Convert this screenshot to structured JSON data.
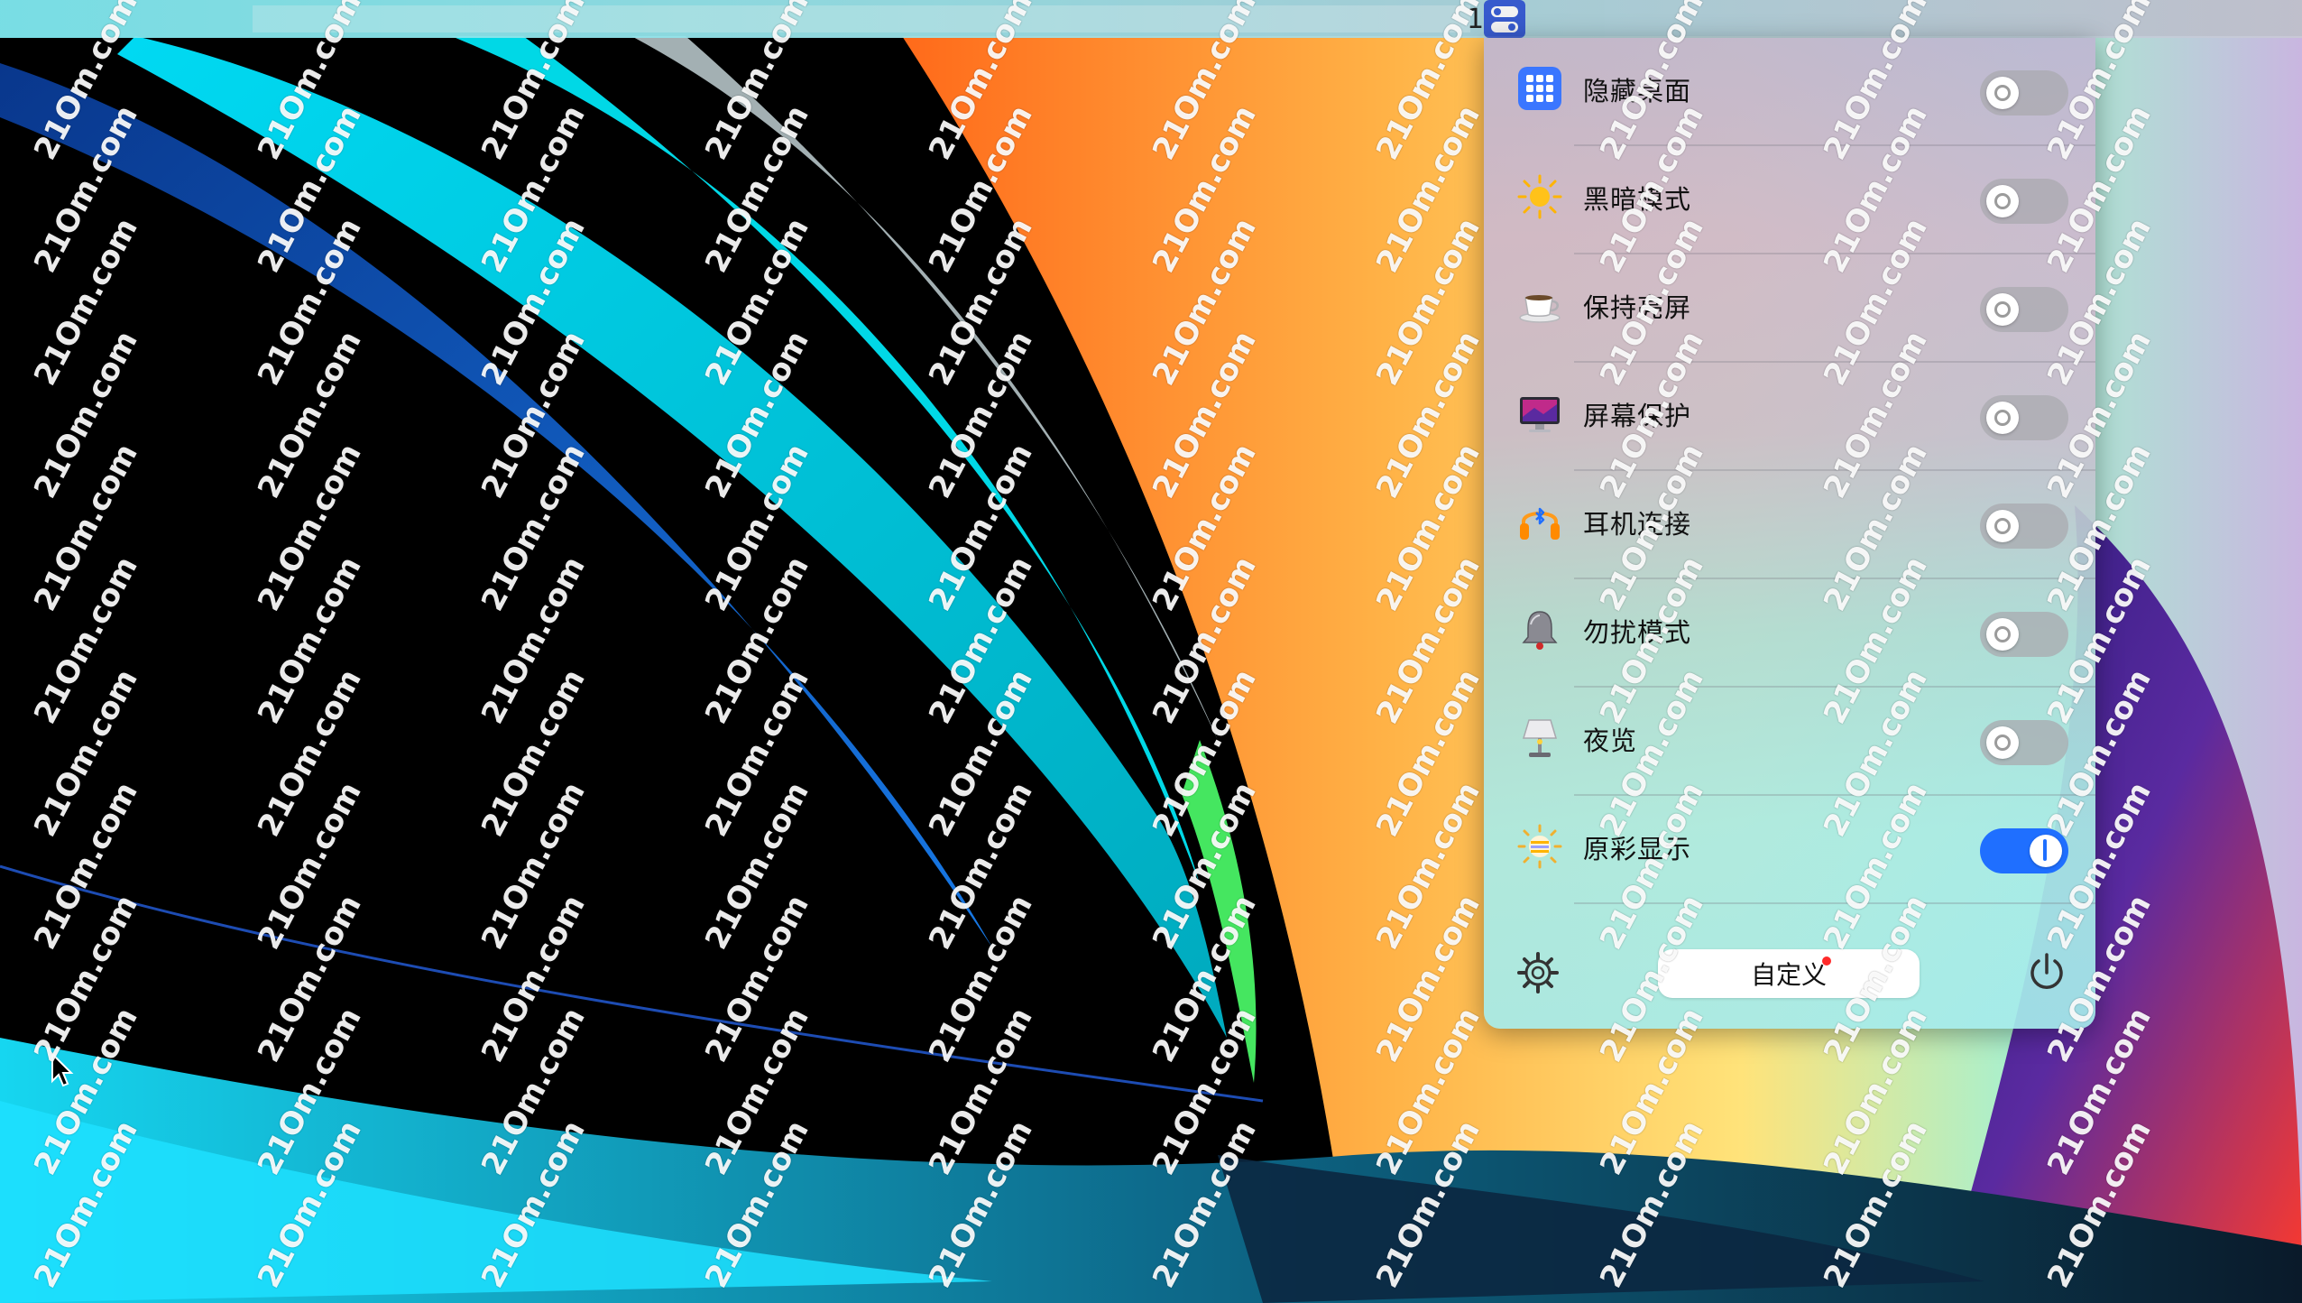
{
  "menubar": {
    "digit": "1",
    "icon": "control-center-toggle-icon"
  },
  "panel": {
    "items": [
      {
        "label": "隐藏桌面",
        "icon": "grid-apps-icon",
        "on": false
      },
      {
        "label": "黑暗模式",
        "icon": "sun-icon",
        "on": false
      },
      {
        "label": "保持亮屏",
        "icon": "coffee-cup-icon",
        "on": false
      },
      {
        "label": "屏幕保护",
        "icon": "monitor-icon",
        "on": false
      },
      {
        "label": "耳机连接",
        "icon": "bluetooth-headphones-icon",
        "on": false
      },
      {
        "label": "勿扰模式",
        "icon": "bell-icon",
        "on": false
      },
      {
        "label": "夜览",
        "icon": "lamp-icon",
        "on": false
      },
      {
        "label": "原彩显示",
        "icon": "color-sun-icon",
        "on": true
      }
    ],
    "footer": {
      "customize_label": "自定义",
      "settings_icon": "gear-icon",
      "power_icon": "power-icon"
    }
  },
  "watermark": "21Om.com",
  "colors": {
    "accent": "#1f6fff",
    "notification": "#ff2a2a"
  }
}
